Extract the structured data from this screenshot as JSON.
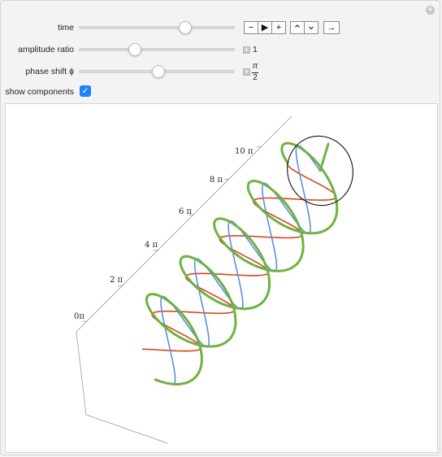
{
  "controls": {
    "time": {
      "label": "time"
    },
    "amplitude_ratio": {
      "label": "amplitude ratio",
      "value": "1"
    },
    "phase_shift": {
      "label": "phase shift ϕ",
      "value_num": "π",
      "value_den": "2"
    },
    "show_components": {
      "label": "show components",
      "checked": true
    }
  },
  "animator": {
    "minus": "−",
    "play": "▶",
    "plus": "+",
    "faster": "⌃",
    "slower": "⌄",
    "direction": "→"
  },
  "axis": {
    "tick_labels": [
      "0π",
      "2 π",
      "4 π",
      "6 π",
      "8 π",
      "10 π"
    ]
  },
  "colors": {
    "green_helix": "#6db33f",
    "red_component": "#d9431e",
    "blue_component": "#5b8fe0",
    "circle": "#111111",
    "checkbox": "#1a82ff"
  },
  "icons": {
    "corner": "plus-circle-icon",
    "expand": "plus-square-icon"
  }
}
